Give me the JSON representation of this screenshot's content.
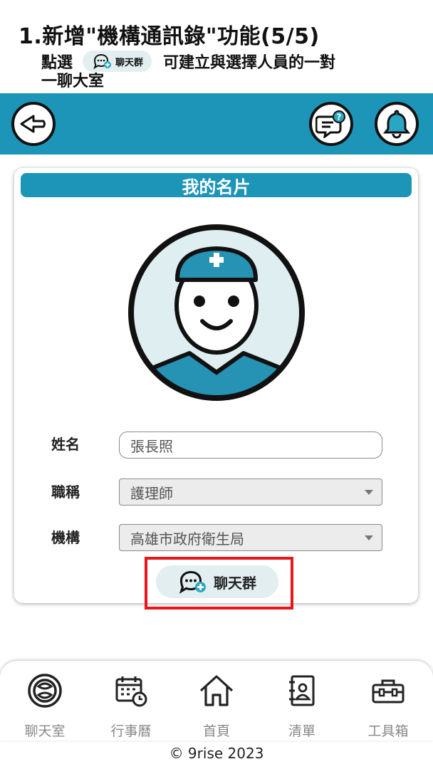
{
  "instruction": {
    "title": "1.新增\"機構通訊錄\"功能(5/5)",
    "line1_prefix": "點選",
    "chip_label": "聊天群",
    "line1_suffix": "可建立與選擇人員的一對",
    "line2": "一聊大室"
  },
  "topbar": {
    "back_icon": "back-arrow-icon",
    "help_icon": "chat-help-icon",
    "bell_icon": "bell-icon",
    "color": "#1d95b8"
  },
  "card": {
    "title": "我的名片",
    "avatar_icon": "nurse-avatar-icon",
    "fields": {
      "name_label": "姓名",
      "name_value": "張長照",
      "title_label": "職稱",
      "title_value": "護理師",
      "org_label": "機構",
      "org_value": "高雄市政府衛生局"
    },
    "chat_button_label": "聊天群"
  },
  "highlight_color": "#e8151b",
  "bottom_nav": {
    "items": [
      {
        "label": "聊天室",
        "icon": "chat-room-icon"
      },
      {
        "label": "行事曆",
        "icon": "calendar-icon"
      },
      {
        "label": "首頁",
        "icon": "home-icon"
      },
      {
        "label": "清單",
        "icon": "contacts-list-icon"
      },
      {
        "label": "工具箱",
        "icon": "toolbox-icon"
      }
    ]
  },
  "footer": "© 9rise 2023"
}
